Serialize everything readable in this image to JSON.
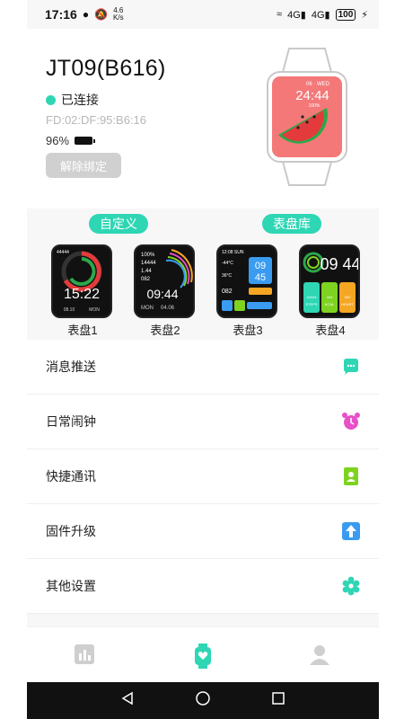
{
  "status_bar": {
    "time": "17:16",
    "speed_value": "4.6",
    "speed_unit": "K/s",
    "signal_left": "4G",
    "signal_right": "4G",
    "battery": "100"
  },
  "device": {
    "name": "JT09(B616)",
    "status": "已连接",
    "mac": "FD:02:DF:95:B6:16",
    "battery_percent": "96%",
    "unbind_label": "解除绑定",
    "preview": {
      "date": "06 · WED",
      "time": "24:44",
      "percent": "100%"
    }
  },
  "tabs": {
    "custom": "自定义",
    "library": "表盘库"
  },
  "faces": [
    {
      "label": "表盘1",
      "time": "15:22",
      "sub_left": "08.10",
      "sub_right": "MON",
      "step": "44444"
    },
    {
      "label": "表盘2",
      "time": "09:44",
      "day": "MON",
      "date": "04.06",
      "batt": "100%",
      "steps": "14444",
      "dist": "1.44",
      "hr": "082"
    },
    {
      "label": "表盘3",
      "top": "12:08 SUN",
      "hour": "09",
      "minute": "45",
      "temp_low": "-44°C",
      "temp": "36°C",
      "hr": "082"
    },
    {
      "label": "表盘4",
      "time": "09 44",
      "steps": "44444",
      "steps_label": "STEPS",
      "kcal": "444",
      "kcal_label": "KCAL",
      "heart": "082",
      "heart_label": "HEART"
    }
  ],
  "menu": [
    {
      "label": "消息推送",
      "icon": "message-icon",
      "color": "#2fd6b4"
    },
    {
      "label": "日常闹钟",
      "icon": "alarm-icon",
      "color": "#e850c8"
    },
    {
      "label": "快捷通讯",
      "icon": "contact-icon",
      "color": "#7ed321"
    },
    {
      "label": "固件升级",
      "icon": "upgrade-icon",
      "color": "#3a9cf0"
    },
    {
      "label": "其他设置",
      "icon": "settings-icon",
      "color": "#2fd6b4"
    }
  ],
  "colors": {
    "accent": "#2fd6b4",
    "watch_screen": "#f47878"
  },
  "bottom_nav": [
    {
      "icon": "stats-icon"
    },
    {
      "icon": "watch-icon"
    },
    {
      "icon": "profile-icon"
    }
  ]
}
